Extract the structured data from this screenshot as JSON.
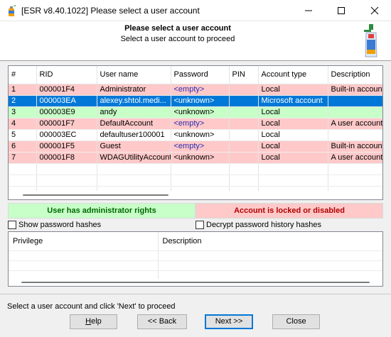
{
  "window": {
    "title": "[ESR v8.40.1022]  Please select a user account"
  },
  "header": {
    "title": "Please select a user account",
    "subtitle": "Select a user account to proceed"
  },
  "accounts": {
    "columns": [
      "#",
      "RID",
      "User name",
      "Password",
      "PIN",
      "Account type",
      "Description"
    ],
    "rows": [
      {
        "n": "1",
        "rid": "000001F4",
        "user": "Administrator",
        "password": "<empty>",
        "pin": "",
        "type": "Local",
        "desc": "Built-in account",
        "state": "red"
      },
      {
        "n": "2",
        "rid": "000003EA",
        "user": "alexey.shtol.medi...",
        "password": "<unknown>",
        "pin": "",
        "type": "Microsoft account",
        "desc": "",
        "state": "sel"
      },
      {
        "n": "3",
        "rid": "000003E9",
        "user": "andy",
        "password": "<unknown>",
        "pin": "",
        "type": "Local",
        "desc": "",
        "state": "green"
      },
      {
        "n": "4",
        "rid": "000001F7",
        "user": "DefaultAccount",
        "password": "<empty>",
        "pin": "",
        "type": "Local",
        "desc": "A user account m",
        "state": "red"
      },
      {
        "n": "5",
        "rid": "000003EC",
        "user": "defaultuser100001",
        "password": "<unknown>",
        "pin": "",
        "type": "Local",
        "desc": "",
        "state": "white"
      },
      {
        "n": "6",
        "rid": "000001F5",
        "user": "Guest",
        "password": "<empty>",
        "pin": "",
        "type": "Local",
        "desc": "Built-in account",
        "state": "red"
      },
      {
        "n": "7",
        "rid": "000001F8",
        "user": "WDAGUtilityAccount",
        "password": "<unknown>",
        "pin": "",
        "type": "Local",
        "desc": "A user account m",
        "state": "red"
      }
    ]
  },
  "legend": {
    "admin": "User has administrator rights",
    "locked": "Account is locked or disabled",
    "admin_color": "#c8ffc8",
    "locked_color": "#ffc9c9"
  },
  "options": {
    "show_hashes": "Show password hashes",
    "decrypt_history": "Decrypt password history hashes"
  },
  "privileges": {
    "columns": [
      "Privilege",
      "Description"
    ]
  },
  "status": "Select a user account and click 'Next' to proceed",
  "buttons": {
    "help_u": "H",
    "help_rest": "elp",
    "back": "<< Back",
    "next": "Next >>",
    "close": "Close"
  },
  "colors": {
    "selection": "#0078d7"
  }
}
